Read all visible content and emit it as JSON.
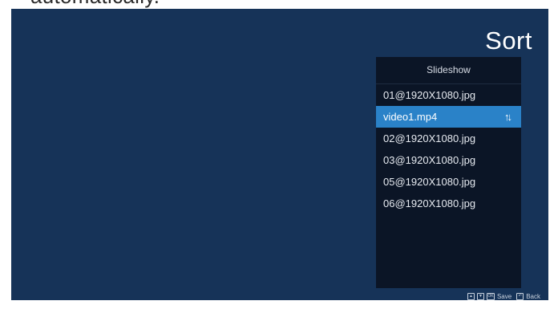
{
  "header_overflow": {
    "text": "automatically."
  },
  "screen": {
    "title": "Sort",
    "panel": {
      "header": "Slideshow",
      "items": [
        {
          "label": "01@1920X1080.jpg",
          "selected": false
        },
        {
          "label": "video1.mp4",
          "selected": true
        },
        {
          "label": "02@1920X1080.jpg",
          "selected": false
        },
        {
          "label": "03@1920X1080.jpg",
          "selected": false
        },
        {
          "label": "05@1920X1080.jpg",
          "selected": false
        },
        {
          "label": "06@1920X1080.jpg",
          "selected": false
        }
      ],
      "sort_icon": "↑↓"
    },
    "hints": {
      "up_icon": "▲",
      "down_icon": "▼",
      "ok_icon": "OK",
      "save_label": "Save",
      "back_icon": "↶",
      "back_label": "Back"
    }
  },
  "colors": {
    "background": "#163358",
    "panel": "#0b1526",
    "selection": "#2a82c8"
  }
}
